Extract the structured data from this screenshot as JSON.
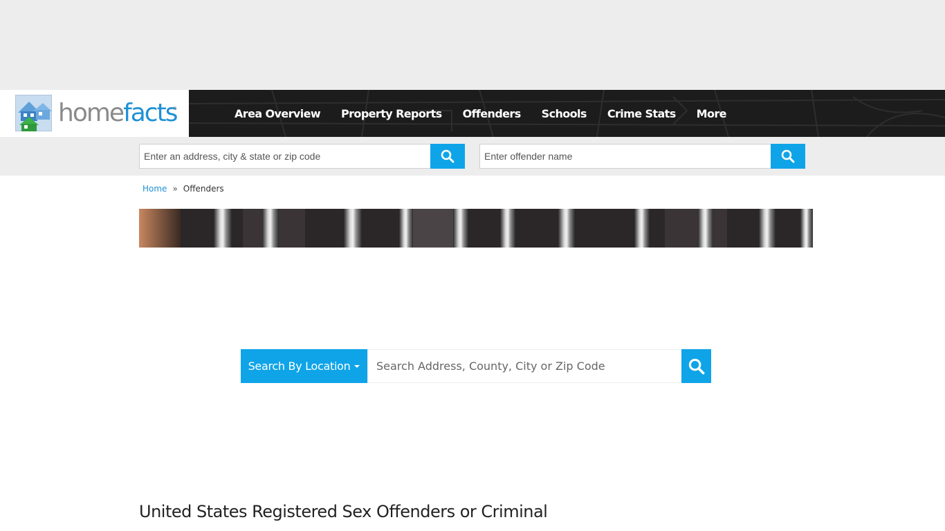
{
  "brand": {
    "home": "home",
    "facts": "facts",
    "tm": "®"
  },
  "nav": [
    {
      "label": "Area Overview"
    },
    {
      "label": "Property Reports"
    },
    {
      "label": "Offenders"
    },
    {
      "label": "Schools"
    },
    {
      "label": "Crime Stats"
    },
    {
      "label": "More"
    }
  ],
  "search": {
    "address_placeholder": "Enter an address, city & state or zip code",
    "offender_placeholder": "Enter offender name"
  },
  "breadcrumb": {
    "home": "Home",
    "separator": "»",
    "current": "Offenders"
  },
  "location_search": {
    "button_label": "Search By Location",
    "placeholder": "Search Address, County, City or Zip Code"
  },
  "page": {
    "title": "United States Registered Sex Offenders or Criminal"
  },
  "colors": {
    "accent": "#0fa4e8",
    "header_bg": "#1c1c1c",
    "band_bg": "#ededed"
  }
}
